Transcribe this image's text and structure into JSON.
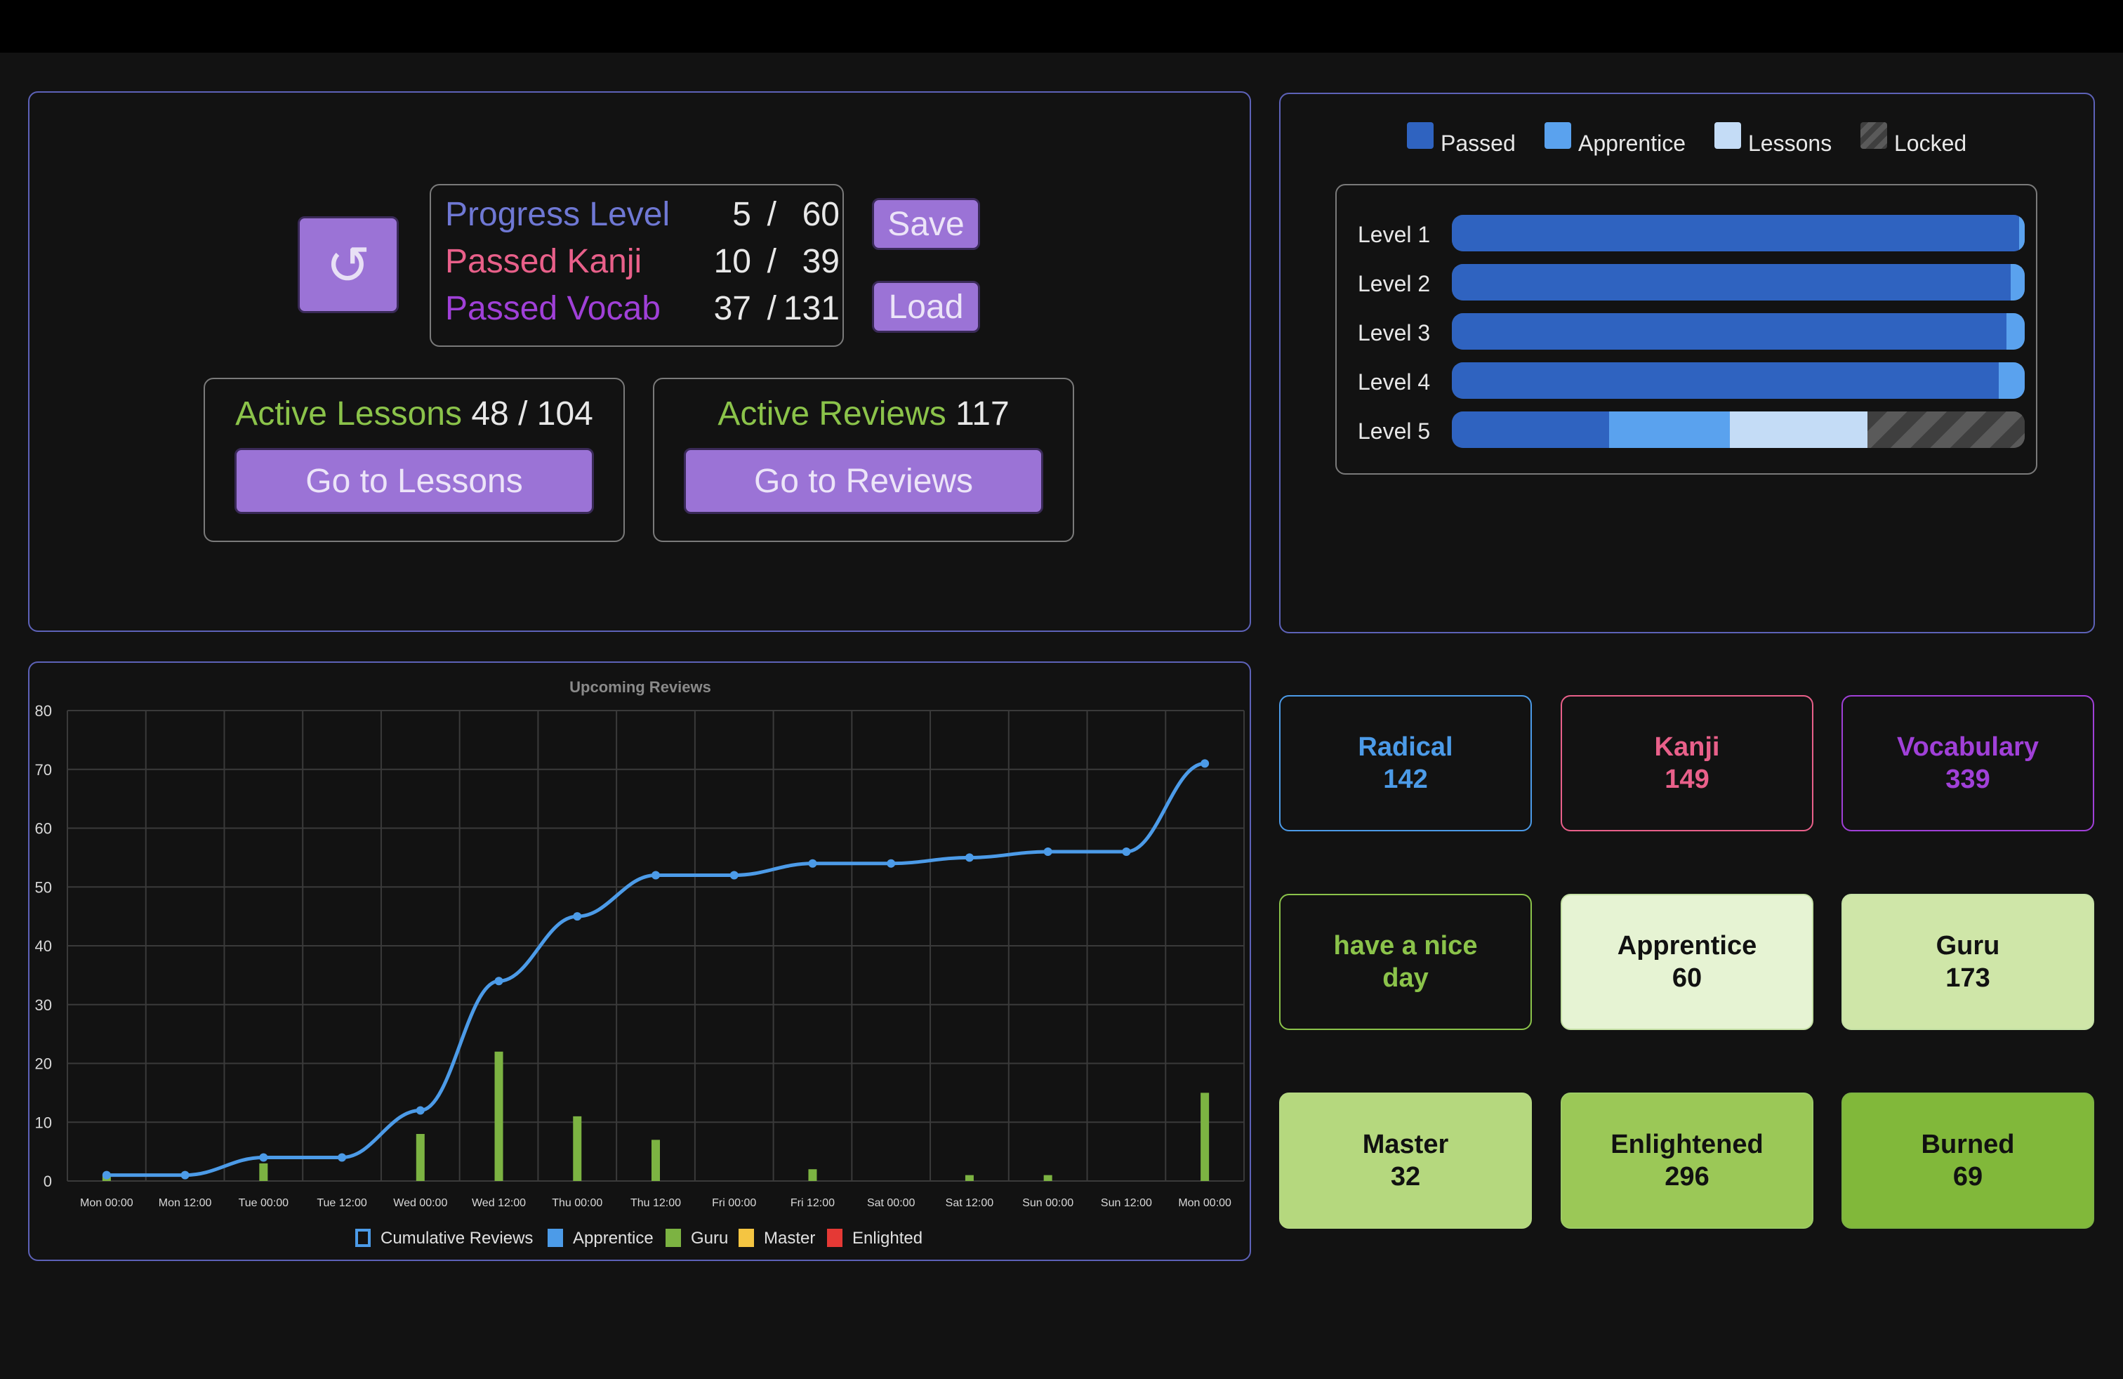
{
  "progress": {
    "reset_icon": "↺",
    "rows": [
      {
        "label": "Progress Level",
        "current": "5",
        "total": "60",
        "color": "#6f78d4"
      },
      {
        "label": "Passed Kanji",
        "current": "10",
        "total": "39",
        "color": "#e9608a"
      },
      {
        "label": "Passed Vocab",
        "current": "37",
        "total": "131",
        "color": "#a040d8"
      }
    ],
    "separator": "/",
    "save_label": "Save",
    "load_label": "Load"
  },
  "lessons": {
    "title": "Active Lessons",
    "value": "48 / 104",
    "button": "Go to Lessons"
  },
  "reviews": {
    "title": "Active Reviews",
    "value": "117",
    "button": "Go to Reviews"
  },
  "levels": {
    "legend": [
      {
        "label": "Passed",
        "color": "#2f63c0"
      },
      {
        "label": "Apprentice",
        "color": "#5aa2ee"
      },
      {
        "label": "Lessons",
        "color": "#c4dcf6"
      },
      {
        "label": "Locked",
        "color": "#4a4a4a"
      }
    ],
    "rows": [
      {
        "name": "Level 1",
        "passed": 0.99,
        "apprentice": 0.01,
        "lessons": 0,
        "locked": 0
      },
      {
        "name": "Level 2",
        "passed": 0.975,
        "apprentice": 0.025,
        "lessons": 0,
        "locked": 0
      },
      {
        "name": "Level 3",
        "passed": 0.968,
        "apprentice": 0.032,
        "lessons": 0,
        "locked": 0
      },
      {
        "name": "Level 4",
        "passed": 0.955,
        "apprentice": 0.045,
        "lessons": 0,
        "locked": 0
      },
      {
        "name": "Level 5",
        "passed": 0.275,
        "apprentice": 0.21,
        "lessons": 0.24,
        "locked": 0.275
      }
    ]
  },
  "chart_data": {
    "type": "bar+line",
    "title": "Upcoming Reviews",
    "categories": [
      "Mon 00:00",
      "Mon 12:00",
      "Tue 00:00",
      "Tue 12:00",
      "Wed 00:00",
      "Wed 12:00",
      "Thu 00:00",
      "Thu 12:00",
      "Fri 00:00",
      "Fri 12:00",
      "Sat 00:00",
      "Sat 12:00",
      "Sun 00:00",
      "Sun 12:00",
      "Mon 00:00"
    ],
    "ylim": [
      0,
      80
    ],
    "yticks": [
      "0",
      "10",
      "20",
      "30",
      "40",
      "50",
      "60",
      "70",
      "80"
    ],
    "series": [
      {
        "name": "Cumulative Reviews",
        "type": "line",
        "color": "#4c9be8",
        "values": [
          1,
          1,
          4,
          4,
          12,
          34,
          45,
          52,
          52,
          54,
          54,
          55,
          56,
          56,
          71
        ]
      },
      {
        "name": "Apprentice",
        "type": "bar",
        "color": "#4c9be8",
        "values": [
          0,
          0,
          0,
          0,
          0,
          0,
          0,
          0,
          0,
          0,
          0,
          0,
          0,
          0,
          0
        ]
      },
      {
        "name": "Guru",
        "type": "bar",
        "color": "#7cb342",
        "values": [
          1,
          0,
          3,
          0,
          8,
          22,
          11,
          7,
          0,
          2,
          0,
          1,
          1,
          0,
          15
        ]
      },
      {
        "name": "Master",
        "type": "bar",
        "color": "#f4c542",
        "values": [
          0,
          0,
          0,
          0,
          0,
          0,
          0,
          0,
          0,
          0,
          0,
          0,
          0,
          0,
          0
        ]
      },
      {
        "name": "Enlighted",
        "type": "bar",
        "color": "#e53935",
        "values": [
          0,
          0,
          0,
          0,
          0,
          0,
          0,
          0,
          0,
          0,
          0,
          0,
          0,
          0,
          0
        ]
      }
    ],
    "grid": true,
    "legend": "bottom"
  },
  "stats": [
    {
      "title": "Radical",
      "value": "142",
      "border": "#4c9be8",
      "bg": "#121212",
      "fg": "#4c9be8"
    },
    {
      "title": "Kanji",
      "value": "149",
      "border": "#e9608a",
      "bg": "#121212",
      "fg": "#e9608a"
    },
    {
      "title": "Vocabulary",
      "value": "339",
      "border": "#a040d8",
      "bg": "#121212",
      "fg": "#a040d8"
    },
    {
      "title": "have a nice day",
      "value": "",
      "border": "#8bc34a",
      "bg": "#121212",
      "fg": "#8bc34a"
    },
    {
      "title": "Apprentice",
      "value": "60",
      "border": "#c5e1a5",
      "bg": "#e6f3d3",
      "fg": "#111111"
    },
    {
      "title": "Guru",
      "value": "173",
      "border": "#c5e1a5",
      "bg": "#cfe6a8",
      "fg": "#111111"
    },
    {
      "title": "Master",
      "value": "32",
      "border": "#b5d882",
      "bg": "#b5d87e",
      "fg": "#111111"
    },
    {
      "title": "Enlightened",
      "value": "296",
      "border": "#9ccc65",
      "bg": "#9bc857",
      "fg": "#111111"
    },
    {
      "title": "Burned",
      "value": "69",
      "border": "#7cb342",
      "bg": "#81b83a",
      "fg": "#111111"
    }
  ]
}
